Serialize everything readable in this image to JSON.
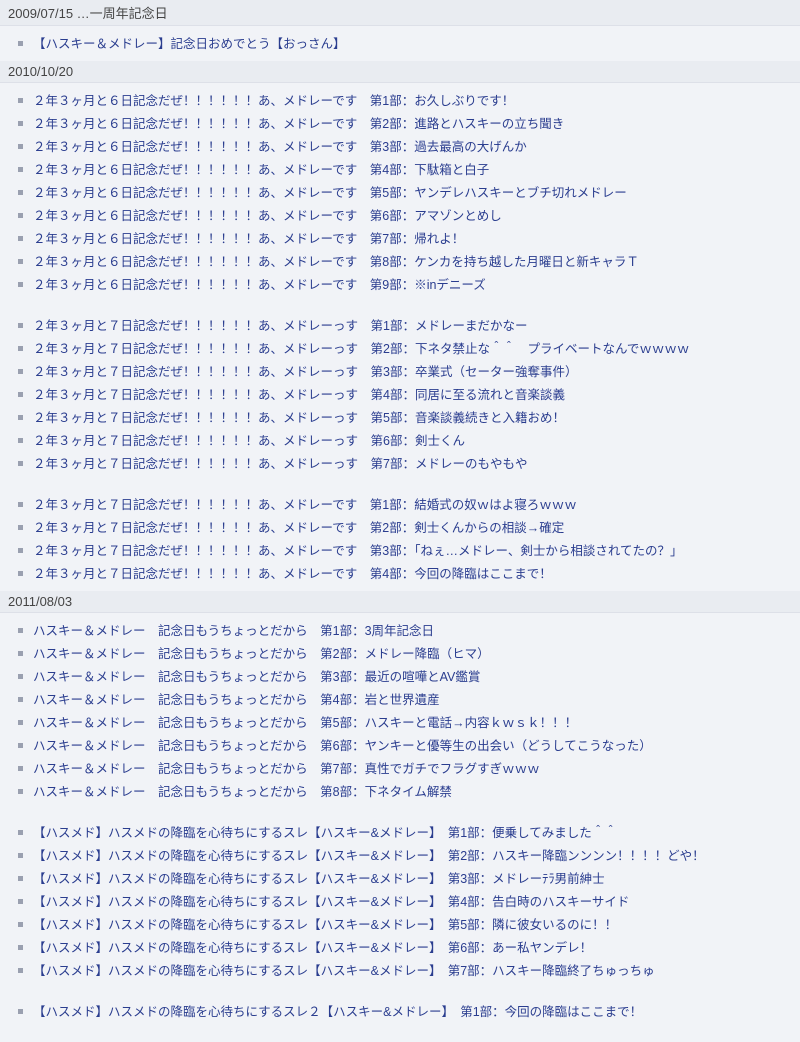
{
  "sections": [
    {
      "header": "2009/07/15 …一周年記念日",
      "groups": [
        [
          "【ハスキー＆メドレー】記念日おめでとう【おっさん】"
        ]
      ]
    },
    {
      "header": "2010/10/20",
      "groups": [
        [
          "２年３ヶ月と６日記念だぜ！！！！！！あ、メドレーです　第1部：お久しぶりです！",
          "２年３ヶ月と６日記念だぜ！！！！！！あ、メドレーです　第2部：進路とハスキーの立ち聞き",
          "２年３ヶ月と６日記念だぜ！！！！！！あ、メドレーです　第3部：過去最高の大げんか",
          "２年３ヶ月と６日記念だぜ！！！！！！あ、メドレーです　第4部：下駄箱と白子",
          "２年３ヶ月と６日記念だぜ！！！！！！あ、メドレーです　第5部：ヤンデレハスキーとブチ切れメドレー",
          "２年３ヶ月と６日記念だぜ！！！！！！あ、メドレーです　第6部：アマゾンとめし",
          "２年３ヶ月と６日記念だぜ！！！！！！あ、メドレーです　第7部：帰れよ！",
          "２年３ヶ月と６日記念だぜ！！！！！！あ、メドレーです　第8部：ケンカを持ち越した月曜日と新キャラＴ",
          "２年３ヶ月と６日記念だぜ！！！！！！あ、メドレーです　第9部：※inデニーズ"
        ],
        [
          "２年３ヶ月と７日記念だぜ！！！！！！あ、メドレーっす　第1部：メドレーまだかなー",
          "２年３ヶ月と７日記念だぜ！！！！！！あ、メドレーっす　第2部：下ネタ禁止な＾＾　プライベートなんでｗｗｗｗ",
          "２年３ヶ月と７日記念だぜ！！！！！！あ、メドレーっす　第3部：卒業式（セーター強奪事件）",
          "２年３ヶ月と７日記念だぜ！！！！！！あ、メドレーっす　第4部：同居に至る流れと音楽談義",
          "２年３ヶ月と７日記念だぜ！！！！！！あ、メドレーっす　第5部：音楽談義続きと入籍おめ！",
          "２年３ヶ月と７日記念だぜ！！！！！！あ、メドレーっす　第6部：剣士くん",
          "２年３ヶ月と７日記念だぜ！！！！！！あ、メドレーっす　第7部：メドレーのもやもや"
        ],
        [
          "２年３ヶ月と７日記念だぜ！！！！！！あ、メドレーです　第1部：結婚式の奴ｗはよ寝ろｗｗｗ",
          "２年３ヶ月と７日記念だぜ！！！！！！あ、メドレーです　第2部：剣士くんからの相談→確定",
          "２年３ヶ月と７日記念だぜ！！！！！！あ、メドレーです　第3部：「ねぇ…メドレー、剣士から相談されてたの？」",
          "２年３ヶ月と７日記念だぜ！！！！！！あ、メドレーです　第4部：今回の降臨はここまで！"
        ]
      ]
    },
    {
      "header": "2011/08/03",
      "groups": [
        [
          "ハスキー＆メドレー　記念日もうちょっとだから　第1部：3周年記念日",
          "ハスキー＆メドレー　記念日もうちょっとだから　第2部：メドレー降臨（ヒマ）",
          "ハスキー＆メドレー　記念日もうちょっとだから　第3部：最近の喧嘩とAV鑑賞",
          "ハスキー＆メドレー　記念日もうちょっとだから　第4部：岩と世界遺産",
          "ハスキー＆メドレー　記念日もうちょっとだから　第5部：ハスキーと電話→内容ｋｗｓｋ！！！",
          "ハスキー＆メドレー　記念日もうちょっとだから　第6部：ヤンキーと優等生の出会い（どうしてこうなった）",
          "ハスキー＆メドレー　記念日もうちょっとだから　第7部：真性でガチでフラグすぎｗｗｗ",
          "ハスキー＆メドレー　記念日もうちょっとだから　第8部：下ネタイム解禁"
        ],
        [
          "【ハスメド】ハスメドの降臨を心待ちにするスレ【ハスキー&メドレー】　第1部：便乗してみました＾＾",
          "【ハスメド】ハスメドの降臨を心待ちにするスレ【ハスキー&メドレー】　第2部：ハスキー降臨ンンンン！！！！どや！",
          "【ハスメド】ハスメドの降臨を心待ちにするスレ【ハスキー&メドレー】　第3部：メドレーﾃﾗ男前紳士",
          "【ハスメド】ハスメドの降臨を心待ちにするスレ【ハスキー&メドレー】　第4部：告白時のハスキーサイド",
          "【ハスメド】ハスメドの降臨を心待ちにするスレ【ハスキー&メドレー】　第5部：隣に彼女いるのに！！",
          "【ハスメド】ハスメドの降臨を心待ちにするスレ【ハスキー&メドレー】　第6部：あー私ヤンデレ！",
          "【ハスメド】ハスメドの降臨を心待ちにするスレ【ハスキー&メドレー】　第7部：ハスキー降臨終了ちゅっちゅ"
        ],
        [
          "【ハスメド】ハスメドの降臨を心待ちにするスレ２【ハスキー&メドレー】　第1部：今回の降臨はここまで！"
        ]
      ]
    }
  ]
}
